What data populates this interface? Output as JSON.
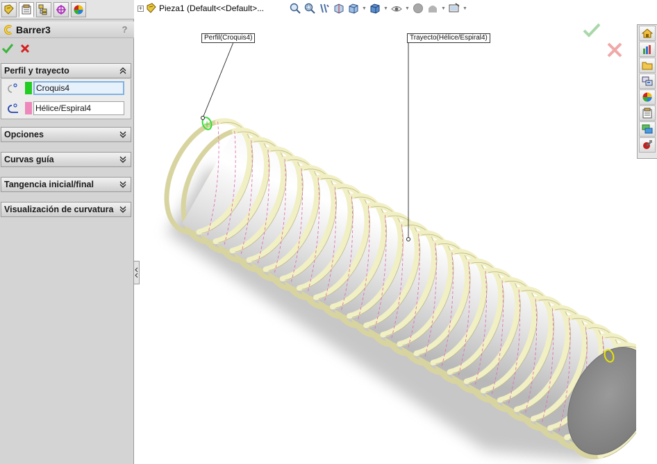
{
  "property_manager": {
    "tabs": [
      "feature-manager-icon",
      "property-manager-icon",
      "configuration-manager-icon",
      "dimxpert-manager-icon",
      "display-manager-icon"
    ],
    "title": "Barrer3",
    "help_label": "?",
    "groups": {
      "perfil": {
        "label": "Perfil y trayecto",
        "profile_value": "Croquis4",
        "profile_color": "#22cc22",
        "path_value": "Hélice/Espiral4",
        "path_color": "#ee88bb"
      },
      "opciones": {
        "label": "Opciones"
      },
      "curvas_guia": {
        "label": "Curvas guía"
      },
      "tangencia": {
        "label": "Tangencia inicial/final"
      },
      "visualizacion": {
        "label": "Visualización de curvatura"
      }
    }
  },
  "feature_tree": {
    "root_label": "Pieza1  (Default<<Default>..."
  },
  "heads_up_toolbar": [
    "zoom-to-fit-icon",
    "zoom-to-area-icon",
    "previous-view-icon",
    "section-view-icon",
    "view-orientation-icon",
    "display-style-icon",
    "hide-show-items-icon",
    "edit-appearance-icon",
    "apply-scene-icon",
    "view-settings-icon"
  ],
  "task_pane": [
    "solidworks-resources-icon",
    "design-library-icon",
    "file-explorer-icon",
    "view-palette-icon",
    "appearances-icon",
    "custom-properties-icon",
    "solidworks-forum-icon",
    "toolbox-icon"
  ],
  "callouts": {
    "profile": "Perfil(Croquis4)",
    "path": "Trayecto(Hélice/Espiral4)"
  },
  "colors": {
    "accept": "#3cb43c",
    "cancel": "#d42020",
    "thread": "#f1efc4",
    "helix": "#e070b0",
    "profile_highlight": "#33dd33",
    "end_profile": "#e6e600"
  }
}
